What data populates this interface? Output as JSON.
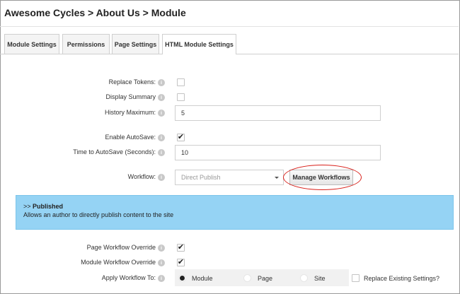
{
  "header": {
    "title": "Awesome Cycles > About Us > Module"
  },
  "tabs": [
    {
      "label": "Module Settings",
      "active": false
    },
    {
      "label": "Permissions",
      "active": false
    },
    {
      "label": "Page Settings",
      "active": false
    },
    {
      "label": "HTML Module Settings",
      "active": true
    }
  ],
  "settings": {
    "replace_tokens": {
      "label": "Replace Tokens:",
      "checked": false
    },
    "display_summary": {
      "label": "Display Summary",
      "checked": false
    },
    "history_maximum": {
      "label": "History Maximum:",
      "value": "5"
    },
    "enable_autosave": {
      "label": "Enable AutoSave:",
      "checked": true
    },
    "time_to_autosave": {
      "label": "Time to AutoSave (Seconds):",
      "value": "10"
    },
    "workflow": {
      "label": "Workflow:",
      "selected": "Direct Publish"
    },
    "manage_workflows_label": "Manage Workflows"
  },
  "workflow_info": {
    "prefix": ">> ",
    "state": "Published",
    "description": "Allows an author to directly publish content to the site"
  },
  "overrides": {
    "page_workflow_override": {
      "label": "Page Workflow Override",
      "checked": true
    },
    "module_workflow_override": {
      "label": "Module Workflow Override",
      "checked": true
    },
    "apply_workflow_to": {
      "label": "Apply Workflow To:",
      "options": [
        "Module",
        "Page",
        "Site"
      ],
      "selected": "Module"
    },
    "replace_existing": {
      "label": "Replace Existing Settings?",
      "checked": false
    }
  },
  "icons": {
    "help": "info-icon",
    "check": "checkmark-icon"
  },
  "colors": {
    "info_panel": "#95d3f4",
    "annotation": "#d9201a"
  }
}
